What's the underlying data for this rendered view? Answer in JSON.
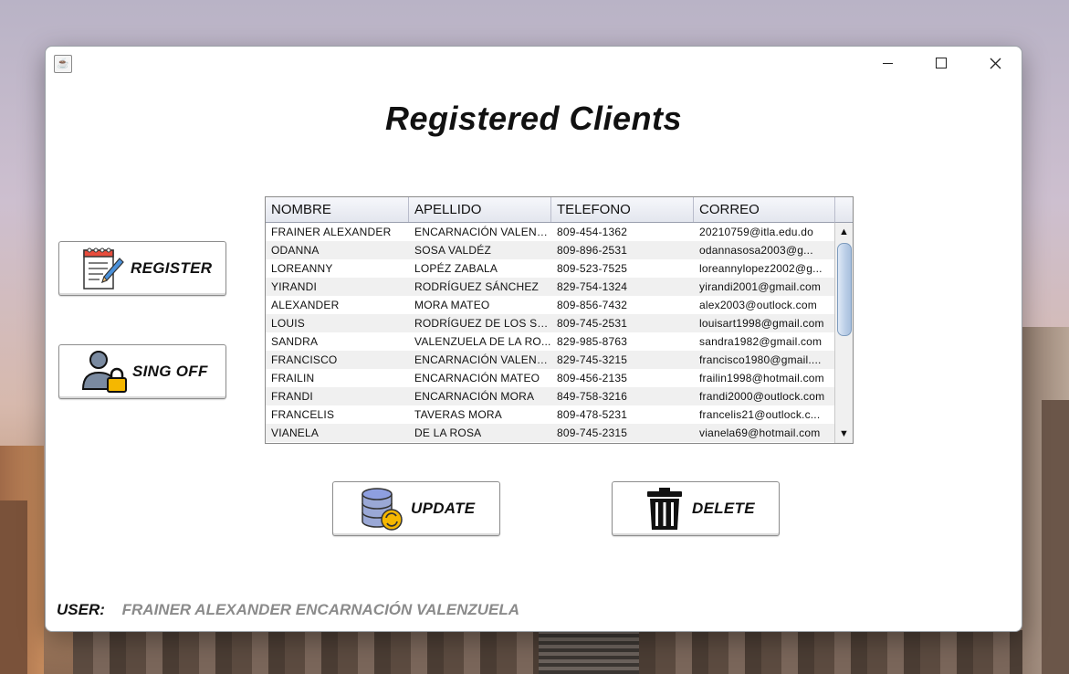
{
  "page": {
    "title": "Registered Clients"
  },
  "buttons": {
    "register": "REGISTER",
    "signoff": "SING OFF",
    "update": "UPDATE",
    "delete": "DELETE"
  },
  "table": {
    "columns": [
      "NOMBRE",
      "APELLIDO",
      "TELEFONO",
      "CORREO"
    ],
    "rows": [
      [
        "FRAINER ALEXANDER",
        "ENCARNACIÓN VALENZ...",
        "809-454-1362",
        "20210759@itla.edu.do"
      ],
      [
        "ODANNA",
        "SOSA VALDÉZ",
        "809-896-2531",
        "odannasosa2003@g..."
      ],
      [
        "LOREANNY",
        "LOPÉZ ZABALA",
        "809-523-7525",
        "loreannylopez2002@g..."
      ],
      [
        "YIRANDI",
        "RODRÍGUEZ SÁNCHEZ",
        "829-754-1324",
        "yirandi2001@gmail.com"
      ],
      [
        "ALEXANDER",
        "MORA MATEO",
        "809-856-7432",
        "alex2003@outlock.com"
      ],
      [
        "LOUIS",
        "RODRÍGUEZ DE LOS SA...",
        "809-745-2531",
        "louisart1998@gmail.com"
      ],
      [
        "SANDRA",
        "VALENZUELA DE LA RO...",
        "829-985-8763",
        "sandra1982@gmail.com"
      ],
      [
        "FRANCISCO",
        "ENCARNACIÓN VALENZ...",
        "829-745-3215",
        "francisco1980@gmail...."
      ],
      [
        "FRAILIN",
        "ENCARNACIÓN MATEO",
        "809-456-2135",
        "frailin1998@hotmail.com"
      ],
      [
        "FRANDI",
        "ENCARNACIÓN MORA",
        "849-758-3216",
        "frandi2000@outlock.com"
      ],
      [
        "FRANCELIS",
        "TAVERAS MORA",
        "809-478-5231",
        "francelis21@outlock.c..."
      ],
      [
        "VIANELA",
        "DE LA ROSA",
        "809-745-2315",
        "vianela69@hotmail.com"
      ]
    ]
  },
  "user": {
    "label": "USER:",
    "name": "FRAINER ALEXANDER ENCARNACIÓN VALENZUELA"
  },
  "colors": {
    "accent_yellow": "#f5b700",
    "user_name_gray": "#8b8b8b"
  }
}
